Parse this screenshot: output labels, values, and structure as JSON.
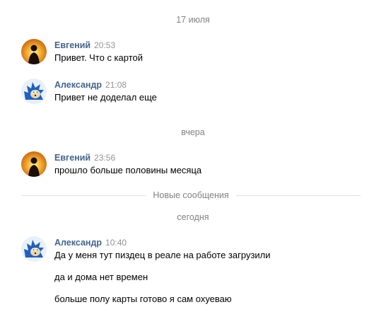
{
  "separators": {
    "date1": "17 июля",
    "date2": "вчера",
    "new_messages": "Новые сообщения",
    "date3": "сегодня"
  },
  "messages": [
    {
      "author": "Евгений",
      "time": "20:53",
      "lines": [
        "Привет. Что с картой"
      ],
      "avatar": "sunset-silhouette-avatar"
    },
    {
      "author": "Александр",
      "time": "21:08",
      "lines": [
        "Привет не доделал еще"
      ],
      "avatar": "sonic-avatar"
    },
    {
      "author": "Евгений",
      "time": "23:56",
      "lines": [
        "прошло больше половины месяца"
      ],
      "avatar": "sunset-silhouette-avatar"
    },
    {
      "author": "Александр",
      "time": "10:40",
      "lines": [
        "Да у меня тут пиздец в реале на работе загрузили",
        "да и дома нет времен",
        "больше полу карты готово я сам охуеваю"
      ],
      "avatar": "sonic-avatar"
    }
  ],
  "colors": {
    "author": "#42648b",
    "meta": "#828282",
    "separator_line": "#dce1e6"
  }
}
